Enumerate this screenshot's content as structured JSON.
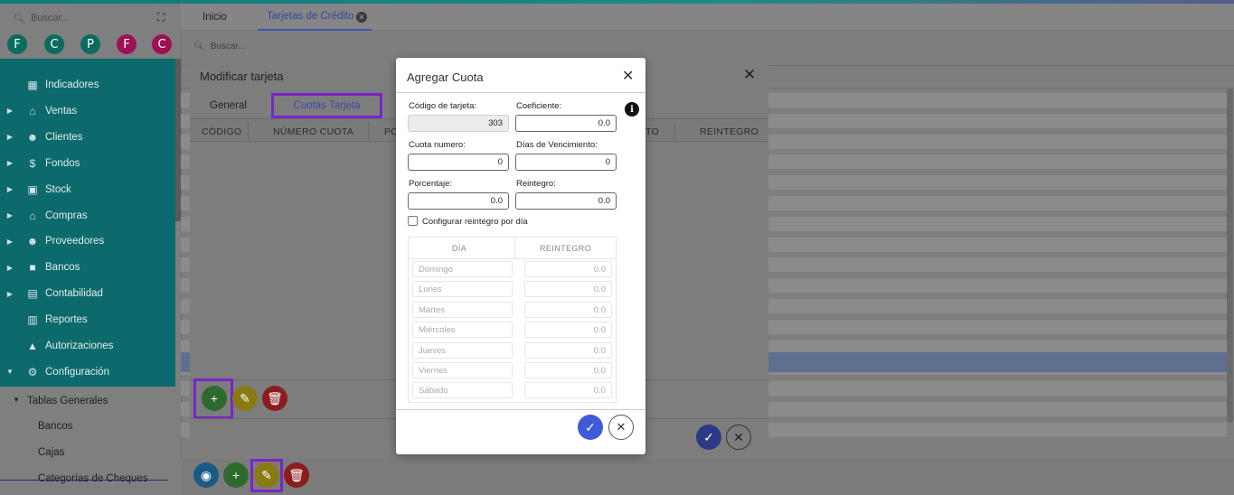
{
  "sidebar": {
    "search_placeholder": "Buscar...",
    "avatars": [
      {
        "letter": "F",
        "color": "#0b6b5e"
      },
      {
        "letter": "C",
        "color": "#0b6b5e"
      },
      {
        "letter": "P",
        "color": "#0b6b5e"
      },
      {
        "letter": "F",
        "color": "#9c1257"
      },
      {
        "letter": "C",
        "color": "#9c1257"
      }
    ],
    "items": [
      {
        "label": "Indicadores",
        "icon": "dashboard-icon"
      },
      {
        "label": "Ventas",
        "icon": "cart-icon"
      },
      {
        "label": "Clientes",
        "icon": "people-icon"
      },
      {
        "label": "Fondos",
        "icon": "dollar-icon"
      },
      {
        "label": "Stock",
        "icon": "box-icon"
      },
      {
        "label": "Compras",
        "icon": "cart-plus-icon"
      },
      {
        "label": "Proveedores",
        "icon": "people-icon"
      },
      {
        "label": "Bancos",
        "icon": "briefcase-icon"
      },
      {
        "label": "Contabilidad",
        "icon": "book-icon"
      },
      {
        "label": "Reportes",
        "icon": "report-icon"
      },
      {
        "label": "Autorizaciones",
        "icon": "lock-icon"
      },
      {
        "label": "Configuración",
        "icon": "gears-icon"
      }
    ],
    "sub_header": "Tablas Generales",
    "sub_items": [
      "Bancos",
      "Cajas",
      "Categorías de Cheques"
    ]
  },
  "tabs": {
    "home": "Inicio",
    "active": "Tarjetas de Crédito"
  },
  "main_search_placeholder": "Buscar...",
  "modify_dialog": {
    "title": "Modificar tarjeta",
    "tab_general": "General",
    "tab_cuotas": "Cuotas Tarjeta",
    "columns": [
      "CÓDIGO",
      "NÚMERO CUOTA",
      "PO",
      "TO",
      "REINTEGRO"
    ]
  },
  "cuota_dialog": {
    "title": "Agregar Cuota",
    "codigo_label": "Código de tarjeta:",
    "codigo_value": "303",
    "coef_label": "Coeficiente:",
    "coef_value": "0.0",
    "cuota_label": "Cuota numero:",
    "cuota_value": "0",
    "dias_label": "Días de Vencimiento:",
    "dias_value": "0",
    "porc_label": "Porcentaje:",
    "porc_value": "0.0",
    "reint_label": "Reintegro:",
    "reint_value": "0.0",
    "checkbox_label": "Configurar reintegro por día",
    "table_headers": [
      "DÍA",
      "REINTEGRO"
    ],
    "days": [
      {
        "day": "Domingo",
        "value": "0.0"
      },
      {
        "day": "Lunes",
        "value": "0.0"
      },
      {
        "day": "Martes",
        "value": "0.0"
      },
      {
        "day": "Miércoles",
        "value": "0.0"
      },
      {
        "day": "Jueves",
        "value": "0.0"
      },
      {
        "day": "Viernes",
        "value": "0.0"
      },
      {
        "day": "Sábado",
        "value": "0.0"
      }
    ]
  },
  "colors": {
    "teal": "#0c6a6c",
    "highlight": "#7b24c9",
    "confirm": "#3f5bd8"
  }
}
